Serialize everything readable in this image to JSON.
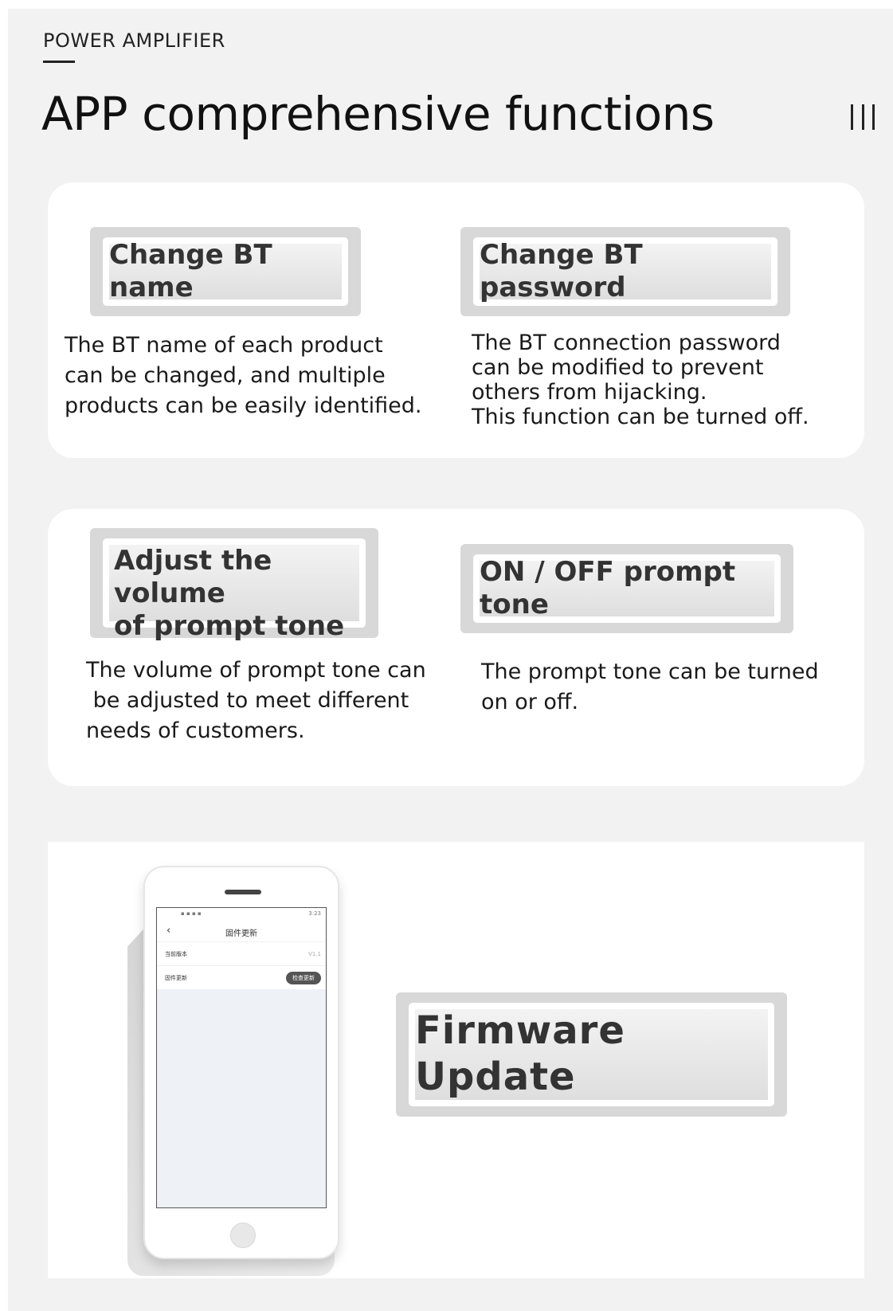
{
  "header": {
    "eyebrow": "POWER AMPLIFIER",
    "title": "APP comprehensive functions"
  },
  "features": [
    {
      "label": "Change BT name",
      "description": [
        "The BT name of each product",
        "can be changed, and multiple",
        "products can be easily identified."
      ]
    },
    {
      "label": "Change BT password",
      "description": [
        "The BT connection password",
        "can be modified to prevent",
        "others from hijacking.",
        "This function can be turned off."
      ]
    },
    {
      "label_line1": "Adjust the volume",
      "label_line2": "of prompt tone",
      "description": [
        "The volume of prompt tone can",
        " be adjusted to meet different",
        "needs of customers."
      ]
    },
    {
      "label": "ON / OFF prompt tone",
      "description": [
        "The prompt tone can be turned",
        "on or off."
      ]
    }
  ],
  "firmware": {
    "label": "Firmware Update",
    "phone": {
      "status_left": "▪ ▪ ▪ ▪",
      "status_right": "3:23",
      "back_symbol": "‹",
      "screen_title": "固件更新",
      "rows": [
        {
          "label": "当前版本",
          "value": "V1.1"
        },
        {
          "label": "固件更新",
          "button": "检查更新"
        }
      ]
    }
  },
  "icons": {
    "menu": "menu-icon",
    "back": "back-icon"
  },
  "colors": {
    "page_bg": "#f2f2f2",
    "card_bg": "#ffffff",
    "plate": "#d8d8d8",
    "text": "#1a1a1a"
  }
}
